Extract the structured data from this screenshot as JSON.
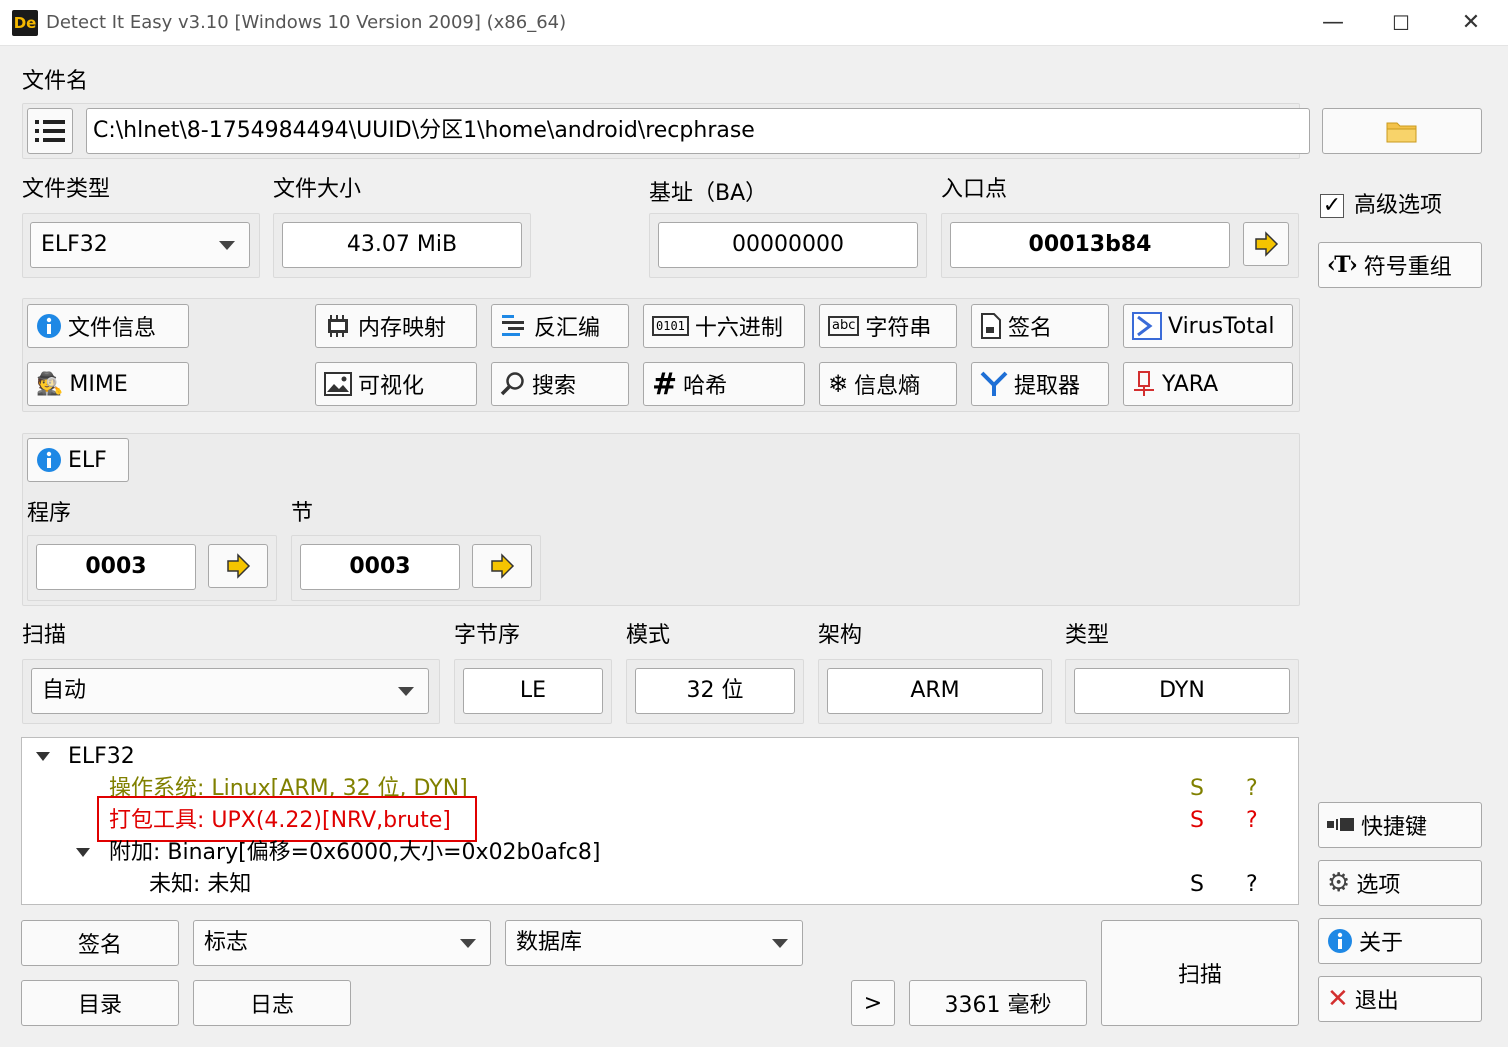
{
  "window": {
    "title": "Detect It Easy v3.10 [Windows 10 Version 2009] (x86_64)",
    "app_icon_text": "De",
    "minimize": "—",
    "maximize": "☐",
    "close": "✕"
  },
  "file": {
    "label": "文件名",
    "path": "C:\\hlnet\\8-1754984494\\UUID\\分区1\\home\\android\\recphrase"
  },
  "info": {
    "file_type_label": "文件类型",
    "file_type": "ELF32",
    "file_size_label": "文件大小",
    "file_size": "43.07 MiB",
    "base_label": "基址（BA）",
    "base": "00000000",
    "entry_label": "入口点",
    "entry": "00013b84"
  },
  "right_panel": {
    "advanced": "高级选项",
    "advanced_checked": true,
    "symbols": "符号重组",
    "shortcuts": "快捷键",
    "options": "选项",
    "about": "关于",
    "exit": "退出"
  },
  "tools": {
    "file_info": "文件信息",
    "memory_map": "内存映射",
    "disasm": "反汇编",
    "hex": "十六进制",
    "strings": "字符串",
    "signature": "签名",
    "virustotal": "VirusTotal",
    "mime": "MIME",
    "visualize": "可视化",
    "search": "搜索",
    "hash": "哈希",
    "entropy": "信息熵",
    "extractor": "提取器",
    "yara": "YARA"
  },
  "elf": {
    "button": "ELF",
    "programs_label": "程序",
    "programs": "0003",
    "sections_label": "节",
    "sections": "0003"
  },
  "scan": {
    "scan_label": "扫描",
    "scan_mode": "自动",
    "endian_label": "字节序",
    "endian": "LE",
    "mode_label": "模式",
    "mode": "32 位",
    "arch_label": "架构",
    "arch": "ARM",
    "type_label": "类型",
    "type": "DYN"
  },
  "results": {
    "root": "ELF32",
    "rows": [
      {
        "text": "操作系统: Linux[ARM, 32 位, DYN]",
        "s": "S",
        "q": "?"
      },
      {
        "text": "打包工具: UPX(4.22)[NRV,brute]",
        "s": "S",
        "q": "?"
      },
      {
        "text": "附加: Binary[偏移=0x6000,大小=0x02b0afc8]",
        "s": "",
        "q": ""
      },
      {
        "text": "未知: 未知",
        "s": "S",
        "q": "?"
      }
    ]
  },
  "bottom": {
    "signatures": "签名",
    "flags": "标志",
    "database": "数据库",
    "directory": "目录",
    "log": "日志",
    "more": ">",
    "time": "3361 毫秒",
    "scan": "扫描"
  },
  "colors": {
    "os_text": "#808000",
    "packer_text": "#e00000",
    "highlight_box": "#e00000",
    "arrow_yellow": "#f5c400"
  }
}
